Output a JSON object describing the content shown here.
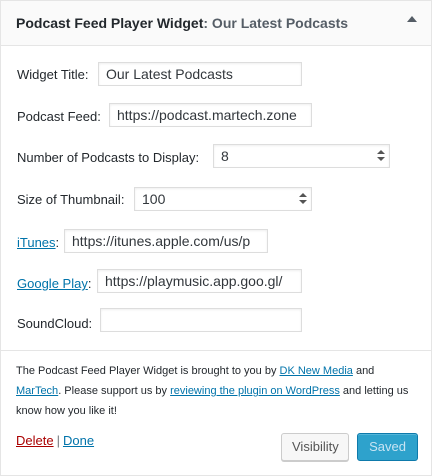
{
  "widget": {
    "name": "Podcast Feed Player Widget",
    "title_suffix": ": Our Latest Podcasts"
  },
  "fields": {
    "widget_title": {
      "label": "Widget Title:",
      "value": "Our Latest Podcasts"
    },
    "podcast_feed": {
      "label": "Podcast Feed:",
      "value": "https://podcast.martech.zone"
    },
    "num_podcasts": {
      "label": "Number of Podcasts to Display:",
      "value": "8"
    },
    "thumb_size": {
      "label": "Size of Thumbnail:",
      "value": "100"
    },
    "itunes": {
      "label": "iTunes",
      "colon": ":",
      "value": "https://itunes.apple.com/us/p"
    },
    "google_play": {
      "label": "Google Play",
      "colon": ":",
      "value": "https://playmusic.app.goo.gl/"
    },
    "soundcloud": {
      "label": "SoundCloud:",
      "value": ""
    }
  },
  "notice": {
    "t1": "The Podcast Feed Player Widget is brought to you by ",
    "link1": "DK New Media",
    "t2": " and ",
    "link2": "MarTech",
    "t3": ". Please support us by ",
    "link3": "reviewing the plugin on WordPress",
    "t4": " and letting us know how you like it!"
  },
  "actions": {
    "delete": "Delete",
    "separator": "|",
    "done": "Done",
    "visibility": "Visibility",
    "saved": "Saved"
  },
  "colors": {
    "link": "#0073aa",
    "delete": "#aa0000",
    "primary_button": "#2ea2cc"
  }
}
